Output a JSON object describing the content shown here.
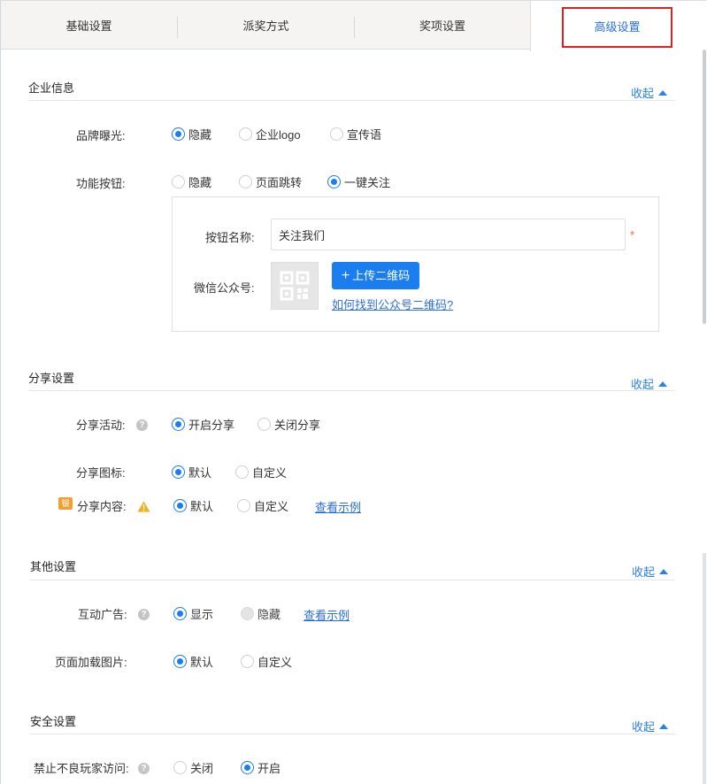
{
  "tabs": [
    {
      "label": "基础设置"
    },
    {
      "label": "派奖方式"
    },
    {
      "label": "奖项设置"
    },
    {
      "label": "高级设置"
    }
  ],
  "collapse_label": "收起",
  "accent_color": "#1a7ef0",
  "icons": {
    "help": "question-circle-icon",
    "warning": "warning-triangle-icon",
    "collapse": "caret-up-icon",
    "plus": "plus-icon",
    "qr": "qr-code-icon"
  },
  "company": {
    "title": "企业信息",
    "brand": {
      "label": "品牌曝光:",
      "options": [
        "隐藏",
        "企业logo",
        "宣传语"
      ],
      "selected": "隐藏"
    },
    "function_button": {
      "label": "功能按钮:",
      "options": [
        "隐藏",
        "页面跳转",
        "一键关注"
      ],
      "selected": "一键关注"
    },
    "button_name_label": "按钮名称:",
    "button_name_value": "关注我们",
    "required_mark": "*",
    "wechat_label": "微信公众号:",
    "upload_label": "上传二维码",
    "qr_help_link": "如何找到公众号二维码?"
  },
  "share": {
    "title": "分享设置",
    "activity": {
      "label": "分享活动:",
      "options": [
        "开启分享",
        "关闭分享"
      ],
      "selected": "开启分享"
    },
    "icon": {
      "label": "分享图标:",
      "options": [
        "默认",
        "自定义"
      ],
      "selected": "默认"
    },
    "content": {
      "label": "分享内容:",
      "badge": "银",
      "options": [
        "默认",
        "自定义"
      ],
      "selected": "默认",
      "example_link": "查看示例"
    }
  },
  "other": {
    "title": "其他设置",
    "ads": {
      "label": "互动广告:",
      "options": [
        "显示",
        "隐藏"
      ],
      "selected": "显示",
      "example_link": "查看示例"
    },
    "loading_image": {
      "label": "页面加载图片:",
      "options": [
        "默认",
        "自定义"
      ],
      "selected": "默认"
    }
  },
  "security": {
    "title": "安全设置",
    "block_bad_players": {
      "label": "禁止不良玩家访问:",
      "options": [
        "关闭",
        "开启"
      ],
      "selected": "开启"
    }
  }
}
